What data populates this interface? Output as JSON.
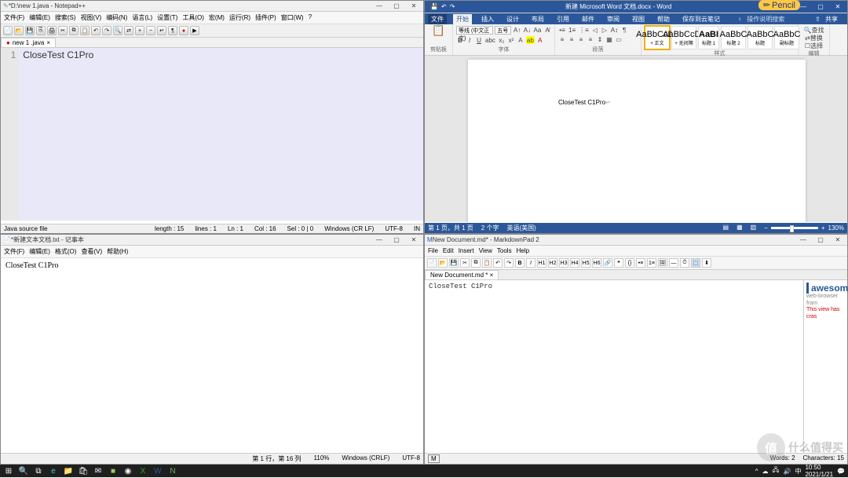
{
  "npp": {
    "title": "*D:\\new 1.java - Notepad++",
    "menu": [
      "文件(F)",
      "编辑(E)",
      "搜索(S)",
      "视图(V)",
      "编码(N)",
      "语言(L)",
      "设置(T)",
      "工具(O)",
      "宏(M)",
      "运行(R)",
      "插件(P)",
      "窗口(W)",
      "?"
    ],
    "tab": "new 1 .java",
    "line_no": "1",
    "code": "CloseTest C1Pro",
    "status": {
      "type": "Java source file",
      "length": "length : 15",
      "lines": "lines : 1",
      "ln": "Ln : 1",
      "col": "Col : 16",
      "sel": "Sel : 0 | 0",
      "eol": "Windows (CR LF)",
      "enc": "UTF-8",
      "ins": "IN"
    }
  },
  "word": {
    "title": "新建 Microsoft Word 文档.docx - Word",
    "pencil": "Pencil",
    "tabs": [
      "文件",
      "开始",
      "插入",
      "设计",
      "布局",
      "引用",
      "邮件",
      "审阅",
      "视图",
      "帮助",
      "保存到云笔记"
    ],
    "search": "操作说明搜索",
    "share": "共享",
    "font_name": "等线 (中文正文)",
    "font_size": "五号",
    "clipboard_label": "剪贴板",
    "font_label": "字体",
    "para_label": "段落",
    "style_label": "样式",
    "edit_label": "编辑",
    "styles": [
      {
        "prev": "AaBbCcDx",
        "name": "+ 正文"
      },
      {
        "prev": "AaBbCcDx",
        "name": "+ 无间隔"
      },
      {
        "prev": "AaBI",
        "name": "标题 1"
      },
      {
        "prev": "AaBbC",
        "name": "标题 2"
      },
      {
        "prev": "AaBbC",
        "name": "标题"
      },
      {
        "prev": "AaBbC",
        "name": "副标题"
      }
    ],
    "edit_items": [
      "查找",
      "替换",
      "选择"
    ],
    "body": "CloseTest C1Pro",
    "status": {
      "page": "第 1 页，共 1 页",
      "words": "2 个字",
      "lang": "英语(美国)",
      "zoom": "130%"
    }
  },
  "notepad": {
    "title": "*新建文本文档.txt - 记事本",
    "menu": [
      "文件(F)",
      "编辑(E)",
      "格式(O)",
      "查看(V)",
      "帮助(H)"
    ],
    "body": "CloseTest C1Pro",
    "status": {
      "pos": "第 1 行，第 16 列",
      "zoom": "110%",
      "eol": "Windows (CRLF)",
      "enc": "UTF-8"
    }
  },
  "mdp": {
    "title": "New Document.md* - MarkdownPad 2",
    "menu": [
      "File",
      "Edit",
      "Insert",
      "View",
      "Tools",
      "Help"
    ],
    "tab": "New Document.md *",
    "body": "CloseTest C1Pro",
    "preview_title": "awesomi",
    "preview_sub": "web-browser fram",
    "preview_err": "This view has cras",
    "status": {
      "mark": "M",
      "words": "Words: 2",
      "chars": "Characters: 15"
    }
  },
  "taskbar": {
    "time": "10:50",
    "date": "2021/1/21"
  },
  "watermark": "什么值得买"
}
